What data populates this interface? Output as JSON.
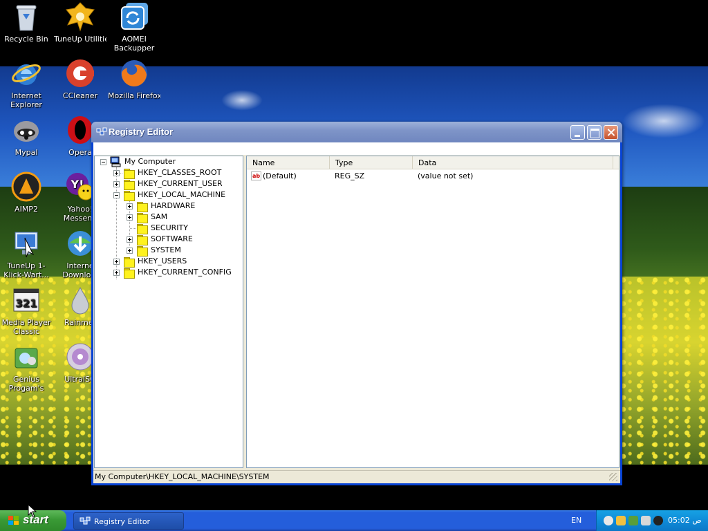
{
  "desktop": {
    "icons": [
      {
        "id": "recycle-bin",
        "label": "Recycle Bin",
        "icon": "recycle-bin-icon"
      },
      {
        "id": "tuneup-utilities",
        "label": "TuneUp Utilities",
        "icon": "tuneup-icon"
      },
      {
        "id": "aomei",
        "label": "AOMEI Backupper",
        "icon": "aomei-backupper-icon"
      },
      {
        "id": "ie",
        "label": "Internet Explorer",
        "icon": "internet-explorer-icon"
      },
      {
        "id": "ccleaner",
        "label": "CCleaner",
        "icon": "ccleaner-icon"
      },
      {
        "id": "firefox",
        "label": "Mozilla Firefox",
        "icon": "firefox-icon"
      },
      {
        "id": "mypal",
        "label": "Mypal",
        "icon": "mypal-icon"
      },
      {
        "id": "opera",
        "label": "Opera",
        "icon": "opera-icon"
      },
      {
        "id": "aimp2",
        "label": "AIMP2",
        "icon": "aimp-icon"
      },
      {
        "id": "yahoo",
        "label": "Yahoo! Messeng",
        "icon": "yahoo-messenger-icon"
      },
      {
        "id": "tuneup-1klick",
        "label": "TuneUp 1-Klick-Wart...",
        "icon": "tuneup-1klick-icon"
      },
      {
        "id": "idm",
        "label": "Interne Downlo...",
        "icon": "download-manager-icon"
      },
      {
        "id": "mpc",
        "label": "Media Player Classic",
        "icon": "media-player-classic-icon"
      },
      {
        "id": "rainmeter",
        "label": "Rainmet",
        "icon": "rainmeter-icon"
      },
      {
        "id": "genius",
        "label": "Genius Progam's",
        "icon": "genius-programs-icon"
      },
      {
        "id": "ultraiso",
        "label": "UltraISO",
        "icon": "ultraiso-icon"
      }
    ]
  },
  "window": {
    "title": "Registry Editor",
    "tree": [
      {
        "label": "My Computer",
        "level": 0,
        "expander": "minus"
      },
      {
        "label": "HKEY_CLASSES_ROOT",
        "level": 1,
        "expander": "plus"
      },
      {
        "label": "HKEY_CURRENT_USER",
        "level": 1,
        "expander": "plus"
      },
      {
        "label": "HKEY_LOCAL_MACHINE",
        "level": 1,
        "expander": "minus"
      },
      {
        "label": "HARDWARE",
        "level": 2,
        "expander": "plus"
      },
      {
        "label": "SAM",
        "level": 2,
        "expander": "plus"
      },
      {
        "label": "SECURITY",
        "level": 2,
        "expander": "none"
      },
      {
        "label": "SOFTWARE",
        "level": 2,
        "expander": "plus"
      },
      {
        "label": "SYSTEM",
        "level": 2,
        "expander": "plus"
      },
      {
        "label": "HKEY_USERS",
        "level": 1,
        "expander": "plus"
      },
      {
        "label": "HKEY_CURRENT_CONFIG",
        "level": 1,
        "expander": "plus"
      }
    ],
    "list": {
      "columns": [
        "Name",
        "Type",
        "Data"
      ],
      "rows": [
        {
          "name": "(Default)",
          "type": "REG_SZ",
          "data": "(value not set)"
        }
      ]
    },
    "status": "My Computer\\HKEY_LOCAL_MACHINE\\SYSTEM"
  },
  "taskbar": {
    "start_label": "start",
    "task_label": "Registry Editor",
    "language": "EN",
    "clock": "05:02 ص"
  },
  "colors": {
    "titlebar_inactive": "#7f95c8",
    "window_frame": "#0843d4",
    "taskbar": "#245edb",
    "start_button": "#3a9a36",
    "tray": "#0f8bd8"
  }
}
